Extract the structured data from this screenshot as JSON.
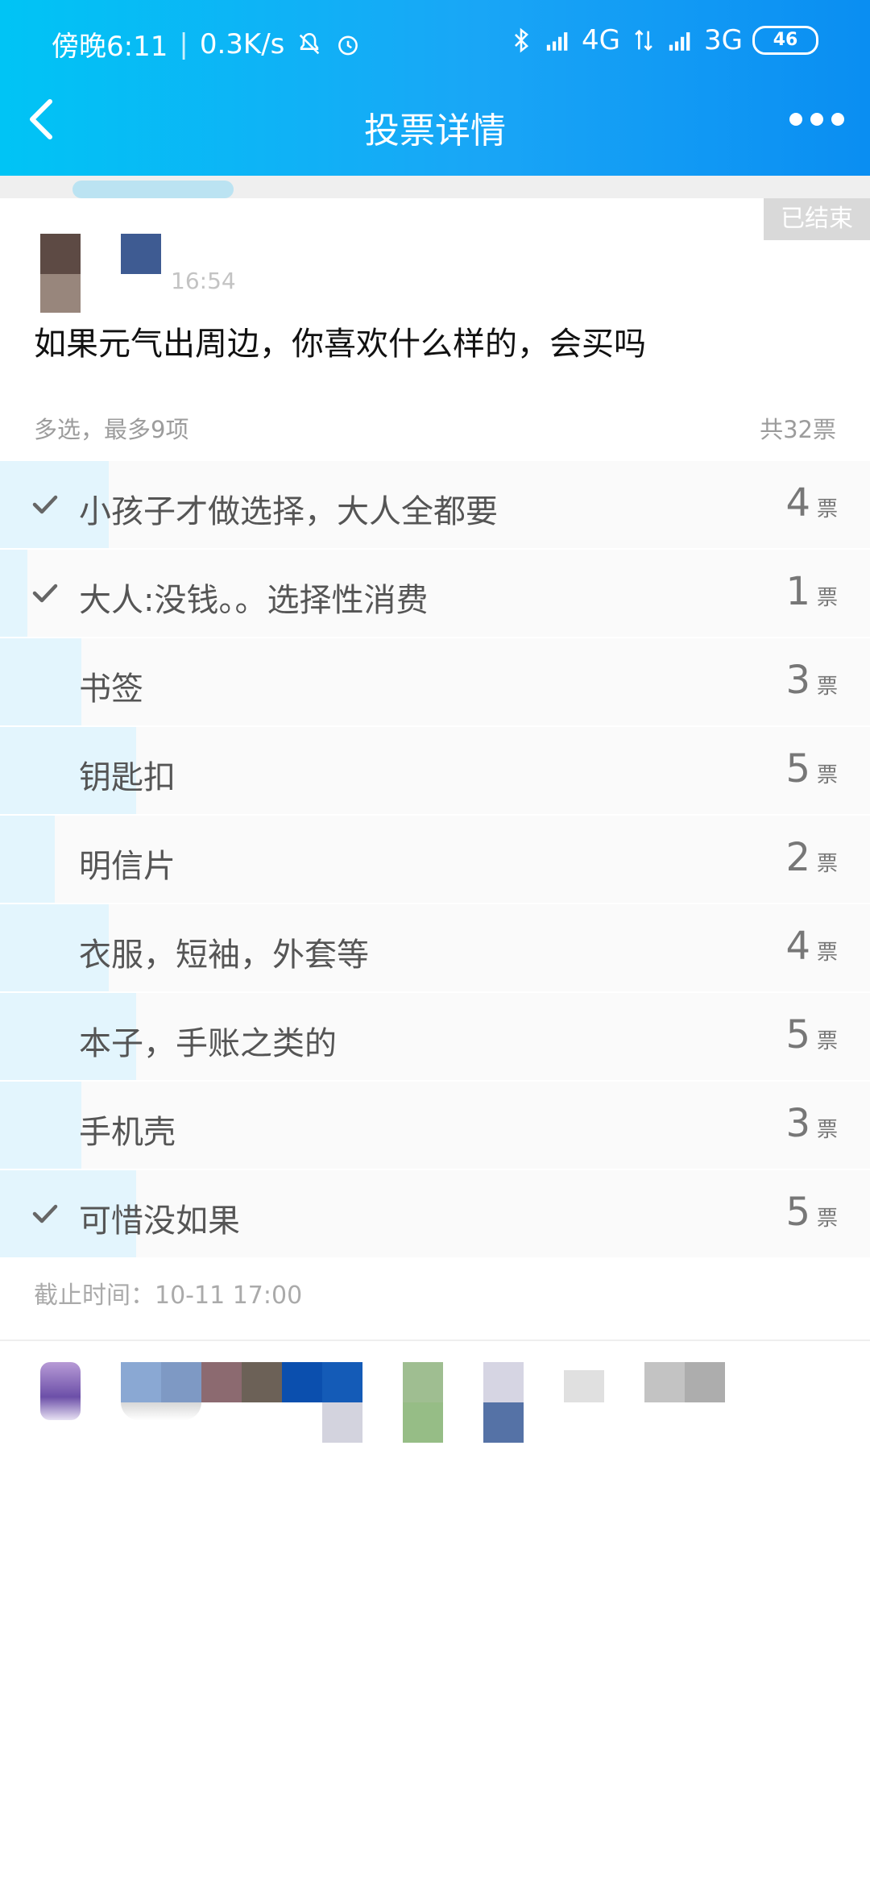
{
  "status_bar": {
    "time": "傍晚6:11",
    "speed": "0.3K/s",
    "network1": "4G",
    "network2": "3G",
    "battery": "46",
    "icons": [
      "mute-icon",
      "alarm-icon",
      "bluetooth-icon",
      "signal-icon",
      "data-arrows-icon",
      "signal-icon"
    ]
  },
  "nav": {
    "title": "投票详情",
    "back_icon": "chevron-left-icon",
    "more_icon": "more-dots-icon"
  },
  "poll": {
    "status_badge": "已结束",
    "post_time": "16:54",
    "question": "如果元气出周边，你喜欢什么样的，会买吗",
    "mode": "多选，最多9项",
    "total": "共32票",
    "vote_unit": "票",
    "total_votes": 32,
    "options": [
      {
        "label": "小孩子才做选择，大人全都要",
        "votes": "4",
        "checked": true
      },
      {
        "label": "大人:没钱。。选择性消费",
        "votes": "1",
        "checked": true
      },
      {
        "label": "书签",
        "votes": "3",
        "checked": false
      },
      {
        "label": "钥匙扣",
        "votes": "5",
        "checked": false
      },
      {
        "label": "明信片",
        "votes": "2",
        "checked": false
      },
      {
        "label": "衣服，短袖，外套等",
        "votes": "4",
        "checked": false
      },
      {
        "label": "本子，手账之类的",
        "votes": "5",
        "checked": false
      },
      {
        "label": "手机壳",
        "votes": "3",
        "checked": false
      },
      {
        "label": "可惜没如果",
        "votes": "5",
        "checked": true
      }
    ],
    "deadline": "截止时间：10-11 17:00"
  },
  "colors": {
    "header_start": "#00c4f5",
    "header_end": "#0a8ef2",
    "option_fill": "#e3f5fd",
    "badge_bg": "#d9d9d9"
  }
}
